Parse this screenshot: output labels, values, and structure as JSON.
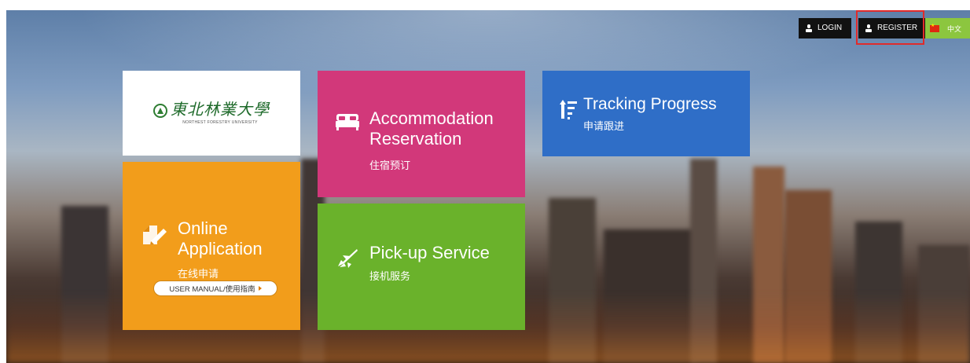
{
  "topbar": {
    "login_label": "LOGIN",
    "register_label": "REGISTER",
    "language_label": "中文"
  },
  "logo": {
    "cn_name": "東北林業大學",
    "en_name": "NORTHEST FORESTRY UNIVERSITY"
  },
  "tiles": {
    "accommodation": {
      "title_line1": "Accommodation",
      "title_line2": "Reservation",
      "subtitle": "住宿预订",
      "color": "#d2387a",
      "icon": "bed-icon"
    },
    "tracking": {
      "title": "Tracking Progress",
      "subtitle": "申请跟进",
      "color": "#2f6ec7",
      "icon": "sort-progress-icon"
    },
    "online": {
      "title_line1": "Online",
      "title_line2": "Application",
      "subtitle": "在线申请",
      "manual_label": "USER MANUAL/使用指南",
      "color": "#f29d1b",
      "icon": "pencil-note-icon"
    },
    "pickup": {
      "title": "Pick-up Service",
      "subtitle": "接机服务",
      "color": "#6ab22b",
      "icon": "plane-icon"
    }
  },
  "colors": {
    "highlight": "#e02b2b",
    "language_bg": "#8cc63f",
    "topbar_bg": "#111111"
  }
}
